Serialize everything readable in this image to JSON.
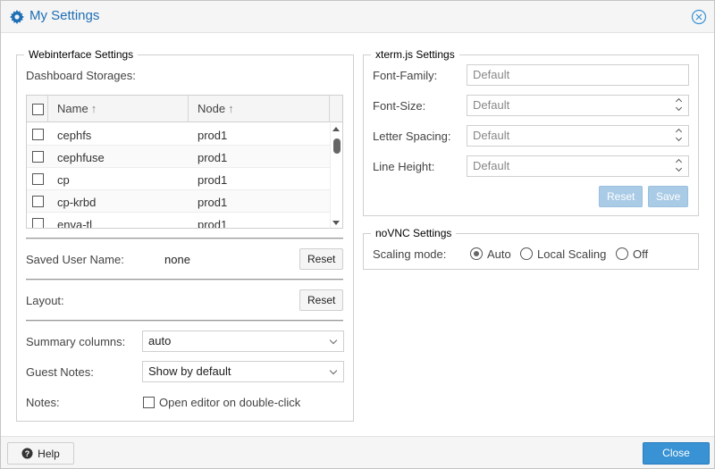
{
  "window": {
    "title": "My Settings",
    "icon": "gear-icon",
    "close_icon": "close-circle-icon"
  },
  "webinterface": {
    "legend": "Webinterface Settings",
    "dashboard_storages_label": "Dashboard Storages:",
    "grid": {
      "columns": [
        "Name",
        "Node"
      ],
      "rows": [
        {
          "name": "cephfs",
          "node": "prod1"
        },
        {
          "name": "cephfuse",
          "node": "prod1"
        },
        {
          "name": "cp",
          "node": "prod1"
        },
        {
          "name": "cp-krbd",
          "node": "prod1"
        },
        {
          "name": "enva-tl",
          "node": "prod1"
        }
      ]
    },
    "saved_user_name_label": "Saved User Name:",
    "saved_user_name_value": "none",
    "reset_label": "Reset",
    "layout_label": "Layout:",
    "summary_columns_label": "Summary columns:",
    "summary_columns_value": "auto",
    "guest_notes_label": "Guest Notes:",
    "guest_notes_value": "Show by default",
    "notes_label": "Notes:",
    "notes_checkbox_label": "Open editor on double-click"
  },
  "xterm": {
    "legend": "xterm.js Settings",
    "font_family_label": "Font-Family:",
    "font_family_value": "Default",
    "font_size_label": "Font-Size:",
    "font_size_value": "Default",
    "letter_spacing_label": "Letter Spacing:",
    "letter_spacing_value": "Default",
    "line_height_label": "Line Height:",
    "line_height_value": "Default",
    "reset_label": "Reset",
    "save_label": "Save"
  },
  "novnc": {
    "legend": "noVNC Settings",
    "scaling_mode_label": "Scaling mode:",
    "options": [
      "Auto",
      "Local Scaling",
      "Off"
    ],
    "selected": "Auto"
  },
  "footer": {
    "help_label": "Help",
    "close_label": "Close"
  },
  "colors": {
    "accent": "#3892d4",
    "title": "#1e6fb5",
    "disabled_button": "#a9cbe6"
  }
}
